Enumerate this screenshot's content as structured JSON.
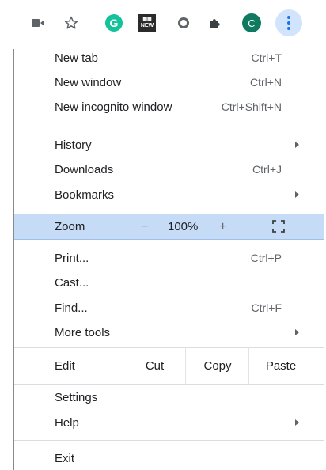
{
  "toolbar": {
    "icons": [
      "video-camera-icon",
      "star-icon",
      "grammarly-icon",
      "new-badge-icon",
      "circle-extension-icon",
      "puzzle-icon",
      "profile-avatar",
      "kebab-menu-icon"
    ],
    "grammarly_letter": "G",
    "new_badge_text": "NEW",
    "avatar_letter": "C",
    "accent": "#1a73e8",
    "menu_button_bg": "#d2e3fc"
  },
  "menu": {
    "new_tab": {
      "label": "New tab",
      "shortcut": "Ctrl+T"
    },
    "new_window": {
      "label": "New window",
      "shortcut": "Ctrl+N"
    },
    "new_incognito": {
      "label": "New incognito window",
      "shortcut": "Ctrl+Shift+N"
    },
    "history": {
      "label": "History"
    },
    "downloads": {
      "label": "Downloads",
      "shortcut": "Ctrl+J"
    },
    "bookmarks": {
      "label": "Bookmarks"
    },
    "zoom": {
      "label": "Zoom",
      "minus": "−",
      "value": "100%",
      "plus": "+"
    },
    "print": {
      "label": "Print...",
      "shortcut": "Ctrl+P"
    },
    "cast": {
      "label": "Cast..."
    },
    "find": {
      "label": "Find...",
      "shortcut": "Ctrl+F"
    },
    "more_tools": {
      "label": "More tools"
    },
    "edit": {
      "label": "Edit",
      "cut": "Cut",
      "copy": "Copy",
      "paste": "Paste"
    },
    "settings": {
      "label": "Settings"
    },
    "help": {
      "label": "Help"
    },
    "exit": {
      "label": "Exit"
    },
    "highlight_color": "#c6dbf5"
  }
}
